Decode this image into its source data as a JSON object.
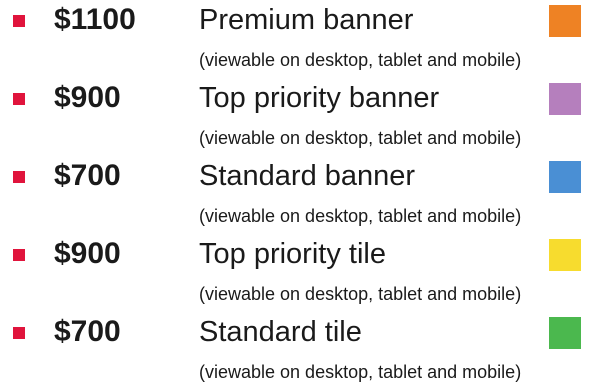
{
  "items": [
    {
      "price": "$1100",
      "label": "Premium banner",
      "note": "(viewable on desktop, tablet and mobile)",
      "color": "#ee8224"
    },
    {
      "price": "$900",
      "label": "Top priority banner",
      "note": "(viewable on desktop, tablet and mobile)",
      "color": "#b57fbd"
    },
    {
      "price": "$700",
      "label": "Standard banner",
      "note": "(viewable on desktop, tablet and mobile)",
      "color": "#4a8fd4"
    },
    {
      "price": "$900",
      "label": "Top priority tile",
      "note": "(viewable on desktop, tablet and mobile)",
      "color": "#f7dc2e"
    },
    {
      "price": "$700",
      "label": "Standard tile",
      "note": "(viewable on desktop, tablet and mobile)",
      "color": "#4bb84e"
    }
  ],
  "bullet_color": "#e0143c"
}
